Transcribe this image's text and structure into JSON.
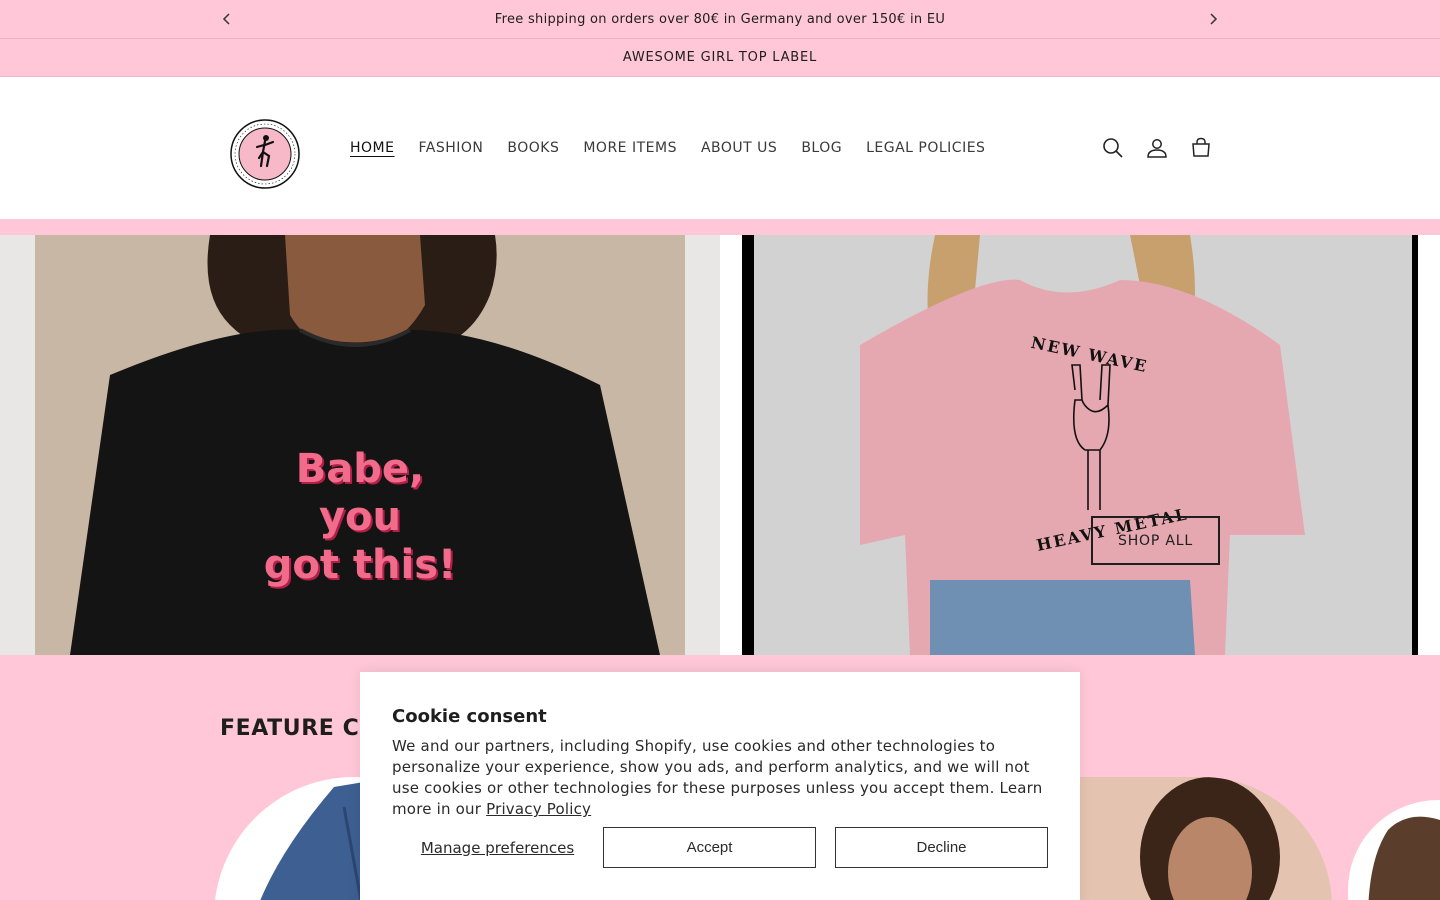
{
  "announcement": {
    "text": "Free shipping on orders over 80€ in Germany and over 150€ in EU",
    "prev_icon": "chevron-left-icon",
    "next_icon": "chevron-right-icon"
  },
  "top_label": "AWESOME GIRL TOP LABEL",
  "nav": {
    "items": [
      {
        "label": "HOME"
      },
      {
        "label": "FASHION"
      },
      {
        "label": "BOOKS"
      },
      {
        "label": "MORE ITEMS"
      },
      {
        "label": "ABOUT US"
      },
      {
        "label": "BLOG"
      },
      {
        "label": "LEGAL POLICIES"
      }
    ],
    "icons": [
      "search-icon",
      "account-icon",
      "cart-icon"
    ]
  },
  "hero": {
    "left_shirt_text_line1": "Babe, you",
    "left_shirt_text_line2": "got this!",
    "right_shirt_text_top": "NEW WAVE",
    "right_shirt_text_bottom": "HEAVY METAL",
    "shop_all_label": "SHOP ALL"
  },
  "feature": {
    "title": "FEATURE COL"
  },
  "cookie": {
    "title": "Cookie consent",
    "body": "We and our partners, including Shopify, use cookies and other technologies to personalize your experience, show you ads, and perform analytics, and we will not use cookies or other technologies for these purposes unless you accept them. Learn more in our ",
    "privacy_link": "Privacy Policy",
    "manage_label": "Manage preferences",
    "accept_label": "Accept",
    "decline_label": "Decline"
  },
  "colors": {
    "brand_pink": "#ffc7d7",
    "shirt_text_pink": "#f06c8a",
    "tshirt_pink": "#e6a8b0"
  }
}
